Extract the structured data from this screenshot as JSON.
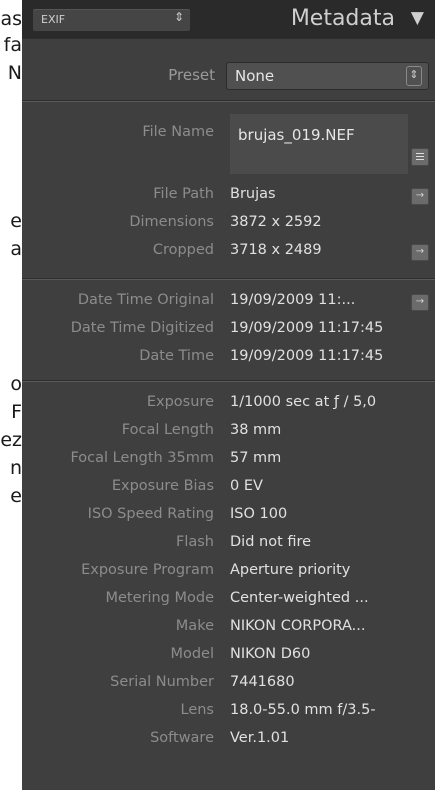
{
  "page_fragments": [
    "as",
    "fa",
    "N",
    "e",
    "a",
    "o",
    "F",
    "ez",
    "n",
    "e"
  ],
  "header": {
    "mode_select": "EXIF",
    "title": "Metadata"
  },
  "preset": {
    "label": "Preset",
    "value": "None"
  },
  "file": {
    "name_label": "File Name",
    "name_value": "brujas_019.NEF",
    "path_label": "File Path",
    "path_value": "Brujas",
    "dimensions_label": "Dimensions",
    "dimensions_value": "3872 x 2592",
    "cropped_label": "Cropped",
    "cropped_value": "3718 x 2489"
  },
  "dates": {
    "original_label": "Date Time Original",
    "original_value": "19/09/2009 11:...",
    "digitized_label": "Date Time Digitized",
    "digitized_value": "19/09/2009 11:17:45",
    "datetime_label": "Date Time",
    "datetime_value": "19/09/2009 11:17:45"
  },
  "exif": [
    {
      "k": "Exposure",
      "v": "1/1000 sec at ƒ / 5,0"
    },
    {
      "k": "Focal Length",
      "v": "38 mm"
    },
    {
      "k": "Focal Length 35mm",
      "v": "57 mm"
    },
    {
      "k": "Exposure Bias",
      "v": "0 EV"
    },
    {
      "k": "ISO Speed Rating",
      "v": "ISO 100"
    },
    {
      "k": "Flash",
      "v": "Did not fire"
    },
    {
      "k": "Exposure Program",
      "v": "Aperture priority"
    },
    {
      "k": "Metering Mode",
      "v": "Center-weighted ..."
    },
    {
      "k": "Make",
      "v": "NIKON CORPORA..."
    },
    {
      "k": "Model",
      "v": "NIKON D60"
    },
    {
      "k": "Serial Number",
      "v": "7441680"
    },
    {
      "k": "Lens",
      "v": "18.0-55.0 mm f/3.5-"
    },
    {
      "k": "Software",
      "v": "Ver.1.01"
    }
  ]
}
